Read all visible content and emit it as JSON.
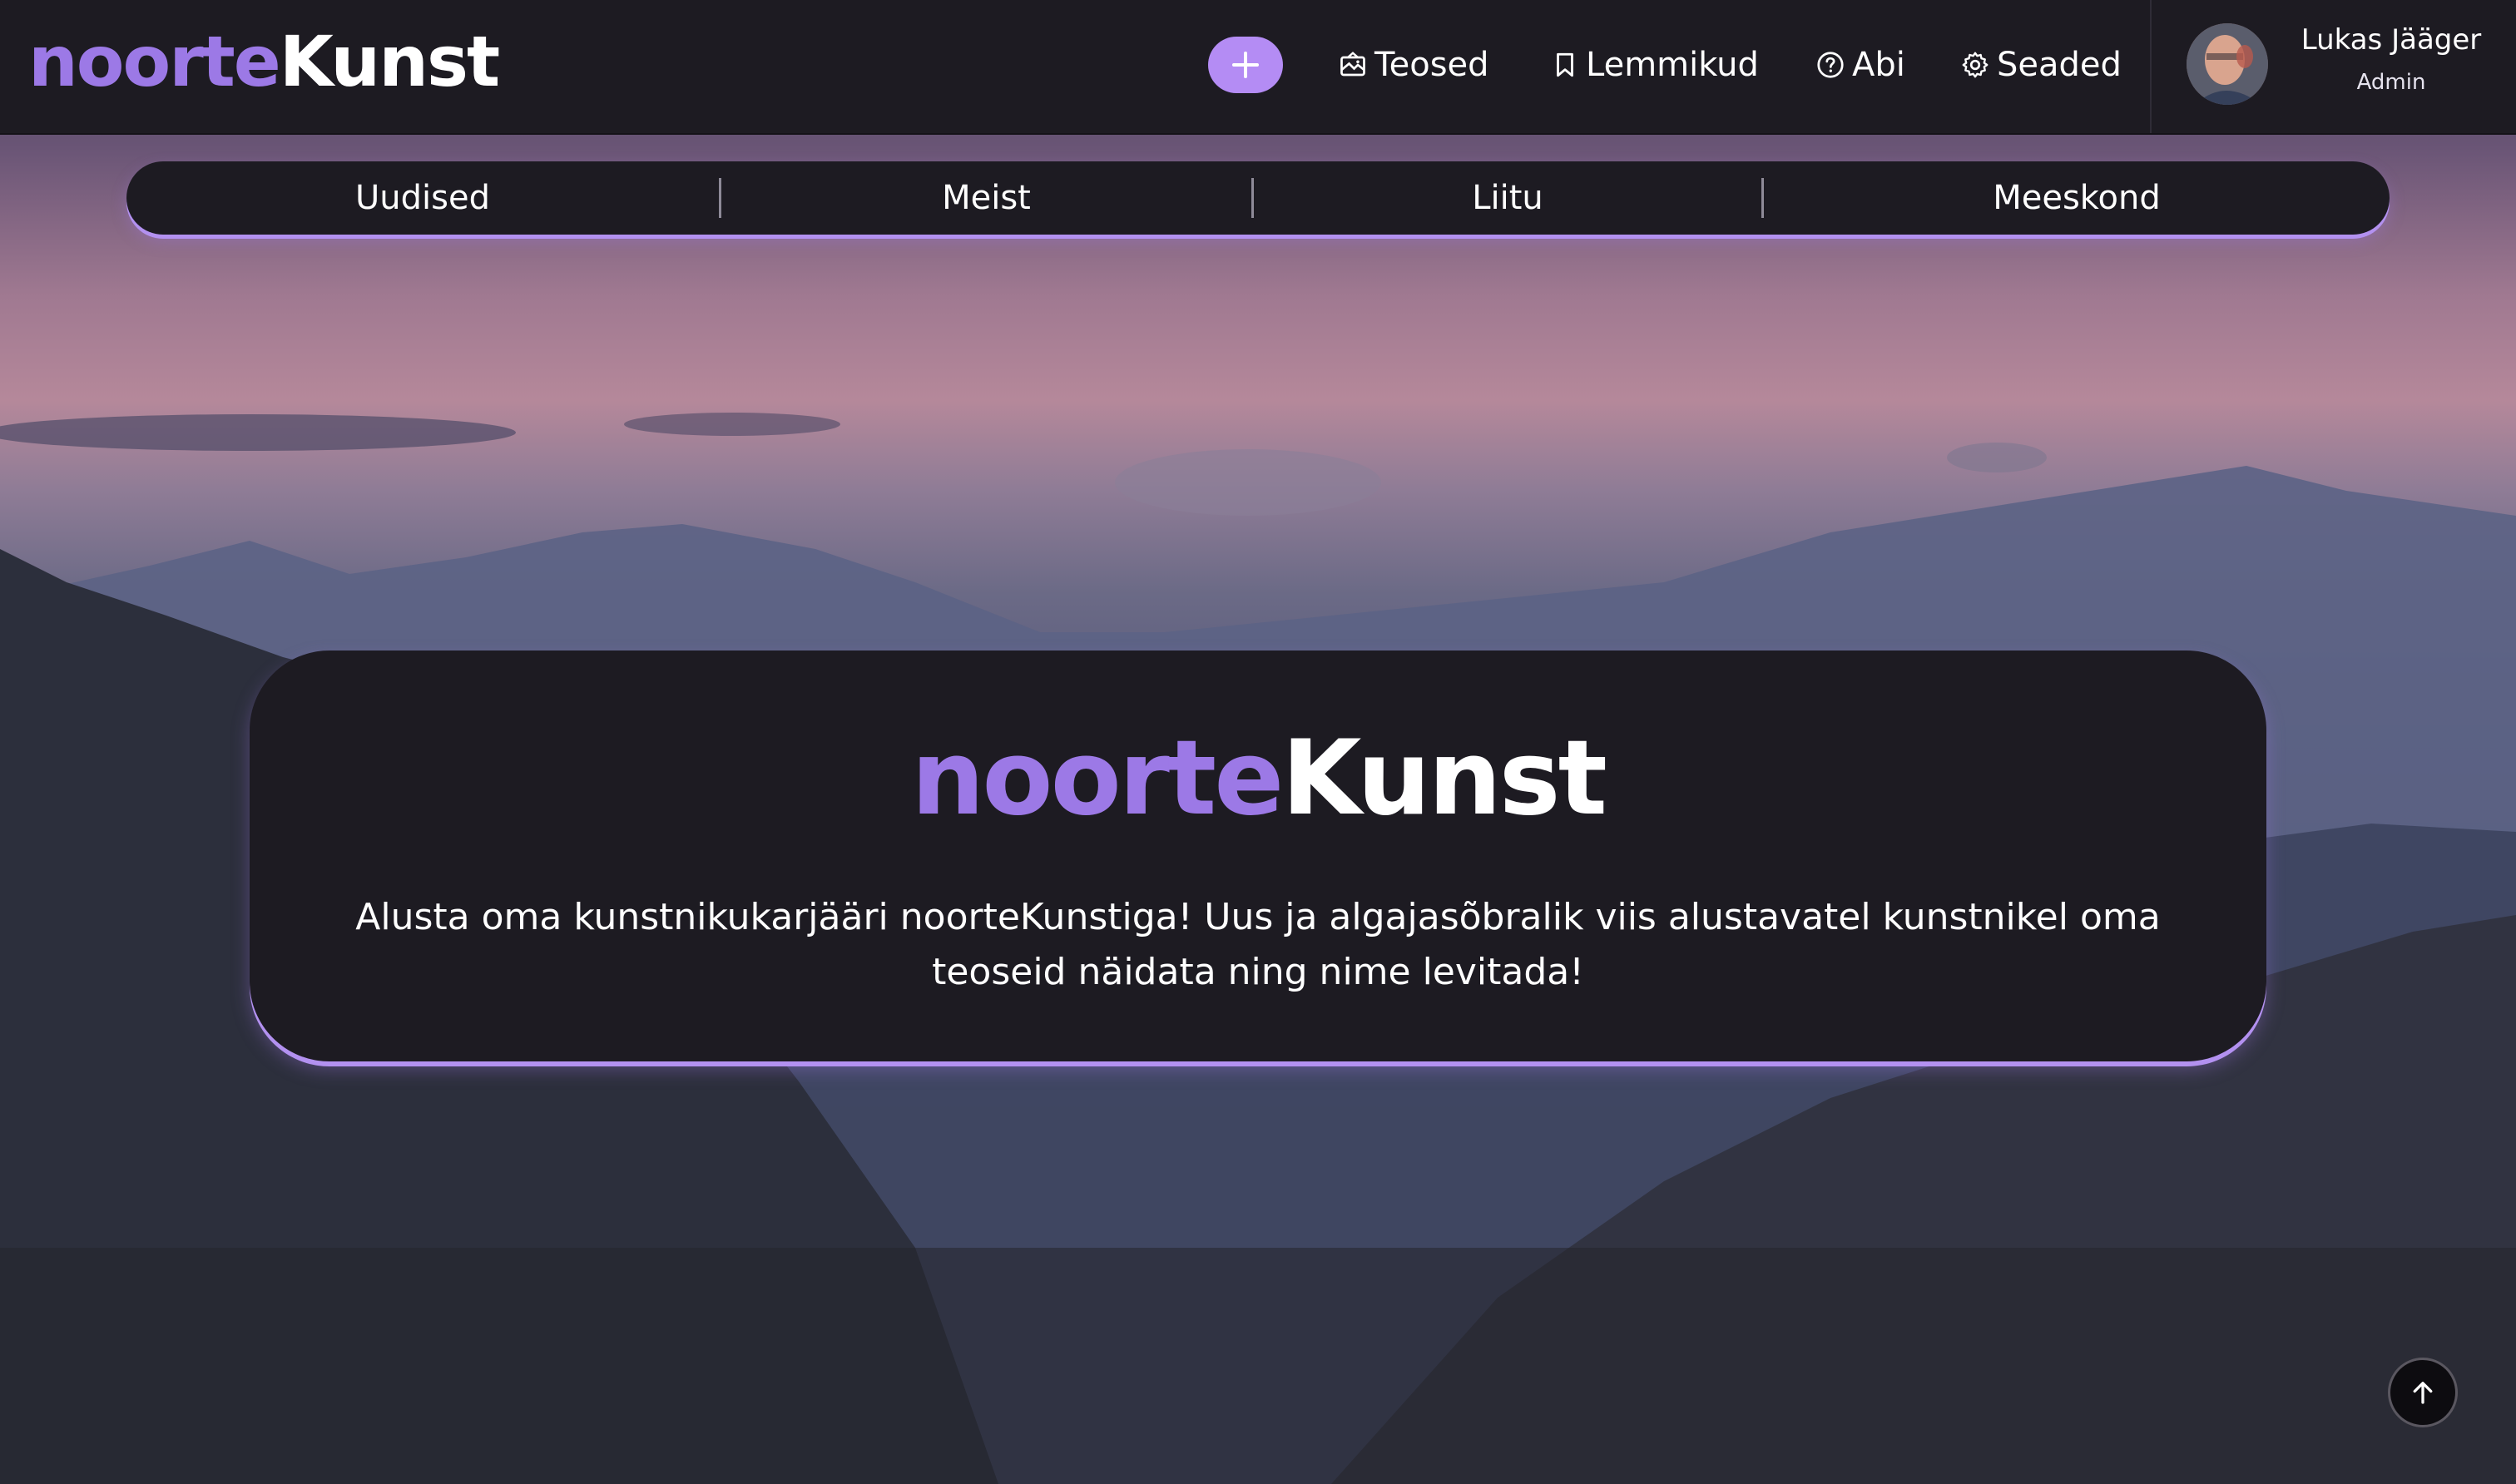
{
  "brand": {
    "logo_part1": "noorte",
    "logo_part2": "Kunst",
    "accent_color": "#9c79e6",
    "button_color": "#b48cf4"
  },
  "topnav": {
    "add_icon": "plus-icon",
    "items": [
      {
        "label": "Teosed",
        "icon": "image-icon"
      },
      {
        "label": "Lemmikud",
        "icon": "bookmark-icon"
      },
      {
        "label": "Abi",
        "icon": "help-icon"
      },
      {
        "label": "Seaded",
        "icon": "gear-icon"
      }
    ]
  },
  "user": {
    "name": "Lukas Jääger",
    "role": "Admin"
  },
  "tabs": [
    "Uudised",
    "Meist",
    "Liitu",
    "Meeskond"
  ],
  "hero": {
    "logo_part1": "noorte",
    "logo_part2": "Kunst",
    "text": "Alusta oma kunstnikukarjääri noorteKunstiga! Uus ja algajasõbralik viis alustavatel kunstnikel oma teoseid näidata ning nime levitada!"
  },
  "scroll_top_icon": "arrow-up-icon"
}
